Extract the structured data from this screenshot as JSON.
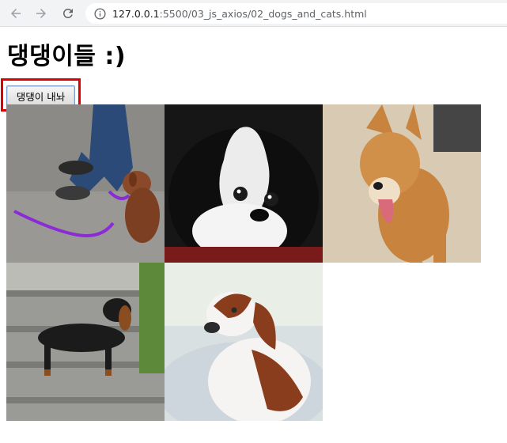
{
  "browser": {
    "url_host": "127.0.0.1",
    "url_path": ":5500/03_js_axios/02_dogs_and_cats.html",
    "back_icon": "arrow-left-icon",
    "forward_icon": "arrow-right-icon",
    "reload_icon": "reload-icon",
    "info_icon": "info-icon"
  },
  "page": {
    "title": "댕댕이들 :)",
    "fetch_button_label": "댕댕이 내놔",
    "highlight_color": "#e00000"
  },
  "gallery": {
    "images": [
      {
        "subject": "toy poodle on leash"
      },
      {
        "subject": "japanese chin"
      },
      {
        "subject": "shiba inu"
      },
      {
        "subject": "dachshund on steps"
      },
      {
        "subject": "hound on chair"
      }
    ]
  }
}
